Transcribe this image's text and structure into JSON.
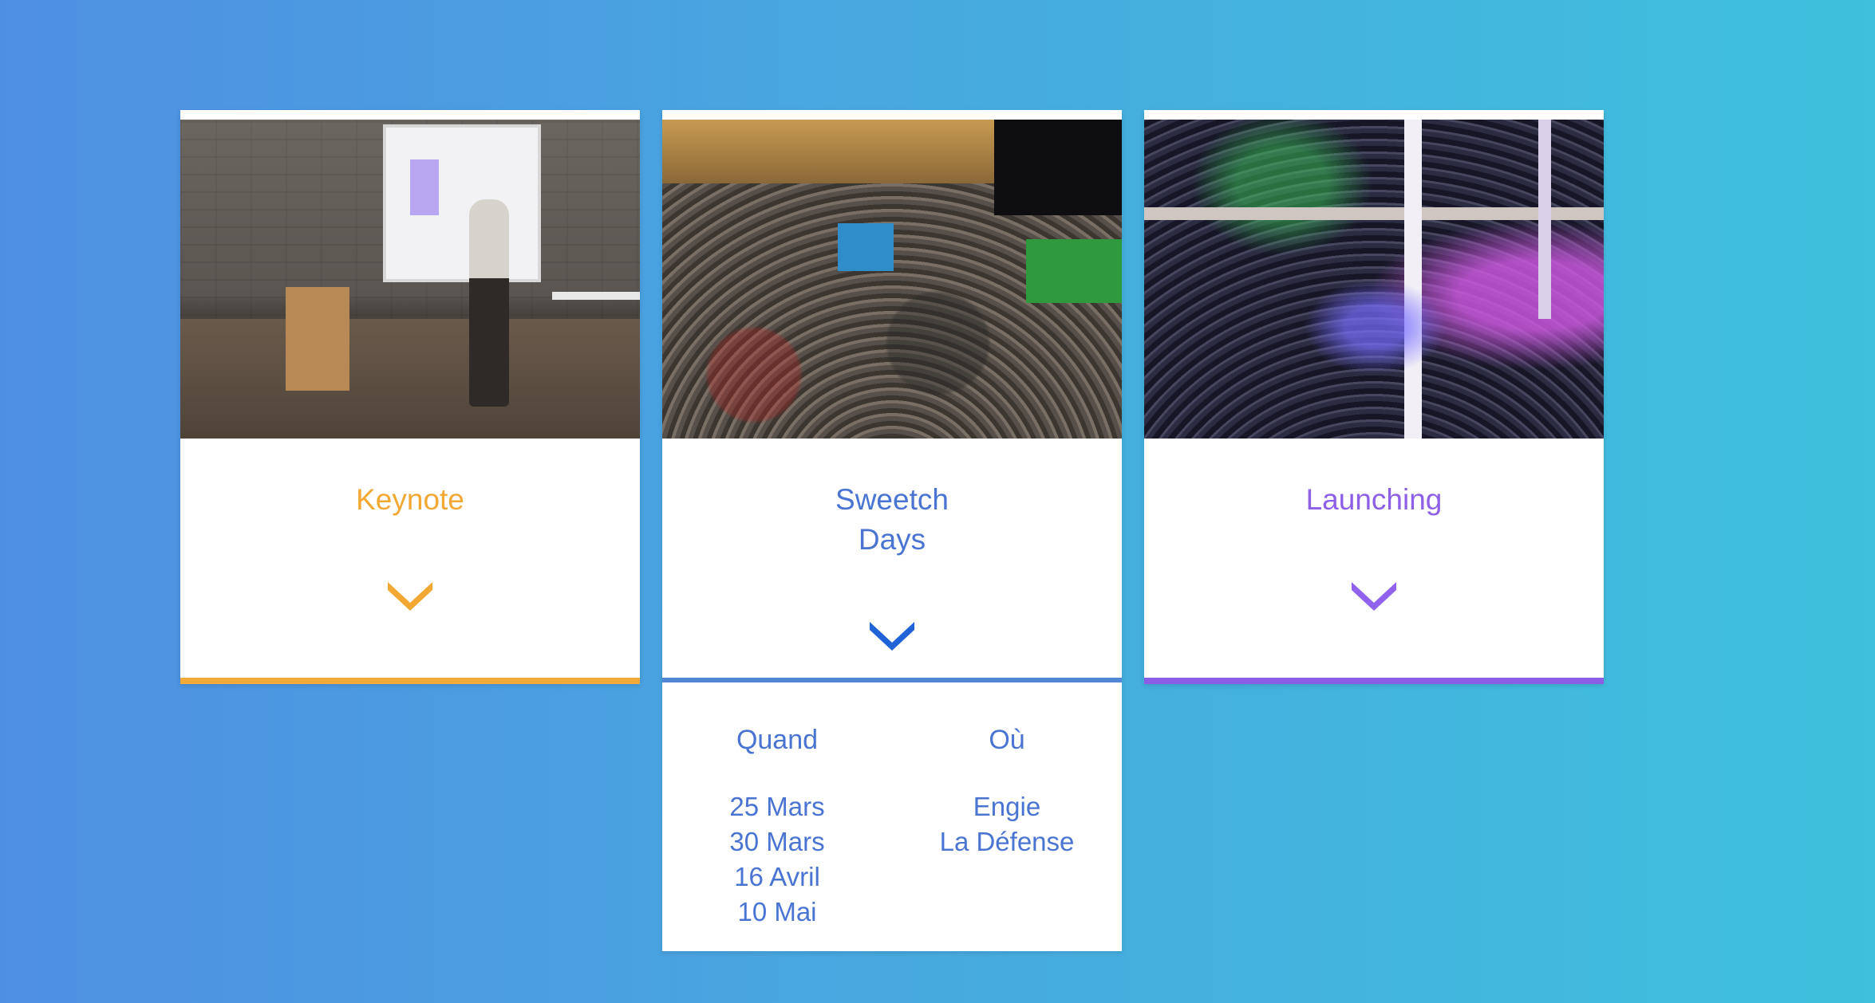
{
  "cards": {
    "keynote": {
      "title": "Keynote",
      "accent": "#f2a833",
      "image_alt": "Speaker presenting slide 02 in a brick-walled room",
      "chevron_icon": "chevron-down-icon"
    },
    "sweetch": {
      "title": "Sweetch\nDays",
      "accent": "#4a74d2",
      "image_alt": "Large hackathon hall with people at round tables",
      "chevron_icon": "chevron-down-icon",
      "details": {
        "when_label": "Quand",
        "where_label": "Où",
        "dates": [
          "25 Mars",
          "30 Mars",
          "16 Avril",
          "10 Mai"
        ],
        "places": [
          "Engie",
          "La Défense"
        ]
      }
    },
    "launching": {
      "title": "Launching",
      "accent": "#8e60e6",
      "image_alt": "Crowd at an evening launch event with purple lighting",
      "chevron_icon": "chevron-down-icon"
    }
  }
}
